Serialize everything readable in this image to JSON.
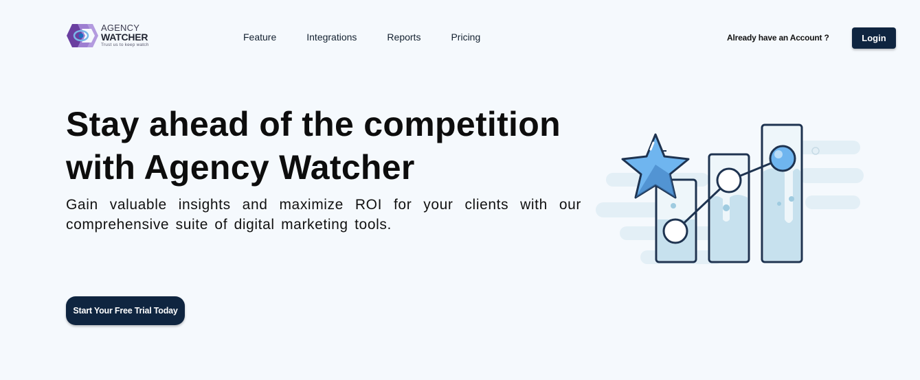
{
  "brand": {
    "name_line1": "AGENCY",
    "name_line2": "WATCHER",
    "tagline": "Trust us to keep watch"
  },
  "nav": {
    "items": [
      "Feature",
      "Integrations",
      "Reports",
      "Pricing"
    ]
  },
  "account": {
    "prompt": "Already have an Account ?",
    "login_label": "Login"
  },
  "hero": {
    "title_line1": "Stay ahead of the competition",
    "title_line2": "with Agency Watcher",
    "subtitle": "Gain valuable insights and maximize ROI for your clients with our comprehensive suite of digital marketing tools.",
    "cta_label": "Start Your Free Trial Today"
  },
  "colors": {
    "background": "#f5f9fd",
    "primary": "#0f2540",
    "illustration_light": "#c7e1ee",
    "illustration_star": "#6fb5ef"
  },
  "icons": {
    "logo": "eye-hexagon-logo-icon",
    "illustration": "growth-chart-star-illustration"
  }
}
